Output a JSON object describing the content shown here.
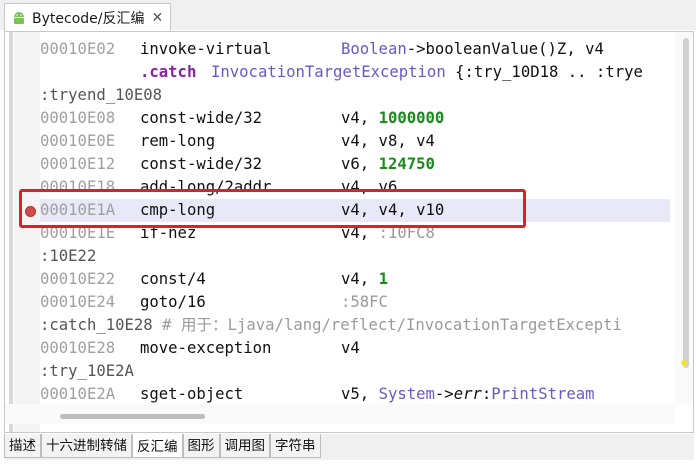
{
  "tab": {
    "title": "Bytecode/反汇编",
    "close": "✕",
    "icon": "android-icon"
  },
  "code": {
    "lines": [
      {
        "addr": "00010E02",
        "op": "invoke-virtual",
        "args_html": "<span class='typ'>Boolean</span>-><span>booleanValue()Z, v4</span>"
      },
      {
        "catch_kw": ".catch",
        "catch_rest": "InvocationTargetException {:try_10D18 .. :trye"
      },
      {
        "label": ":tryend_10E08"
      },
      {
        "addr": "00010E08",
        "op": "const-wide/32",
        "args": "v4, ",
        "num": "1000000"
      },
      {
        "addr": "00010E0E",
        "op": "rem-long",
        "args": "v4, v8, v4"
      },
      {
        "addr": "00010E12",
        "op": "const-wide/32",
        "args": "v6, ",
        "num": "124750"
      },
      {
        "addr": "00010E18",
        "op": "add-long/2addr",
        "args": "v4, v6"
      },
      {
        "addr": "00010E1A",
        "op": "cmp-long",
        "args": "v4, v4, v10",
        "highlight": true
      },
      {
        "addr": "00010E1E",
        "op": "if-nez",
        "args": "v4, ",
        "lbl": ":10FC8"
      },
      {
        "label": ":10E22"
      },
      {
        "addr": "00010E22",
        "op": "const/4",
        "args": "v4, ",
        "num": "1"
      },
      {
        "addr": "00010E24",
        "op": "goto/16",
        "lbl": ":58FC"
      },
      {
        "label": ":catch_10E28",
        "comment": " # 用于：Ljava/lang/reflect/InvocationTargetExcepti"
      },
      {
        "addr": "00010E28",
        "op": "move-exception",
        "args": "v4"
      },
      {
        "label": ":try_10E2A"
      },
      {
        "addr": "00010E2A",
        "op": "sget-object",
        "args": "v5, "
      }
    ],
    "sget_type": "System",
    "sget_field": "err",
    "sget_sep": ":",
    "sget_ret": "PrintStream",
    "catch_type": "InvocationTargetException",
    "catch_tail": " {:try_10D18 .. :trye"
  },
  "bottom_tabs": [
    "描述",
    "十六进制转储",
    "反汇编",
    "图形",
    "调用图",
    "字符串"
  ],
  "active_bottom_tab": "反汇编",
  "colors": {
    "highlight": "#e8e8f8",
    "red_box": "#e02020",
    "number": "#1a8c1a",
    "type": "#6a57c9",
    "catch": "#8b1fa8"
  }
}
